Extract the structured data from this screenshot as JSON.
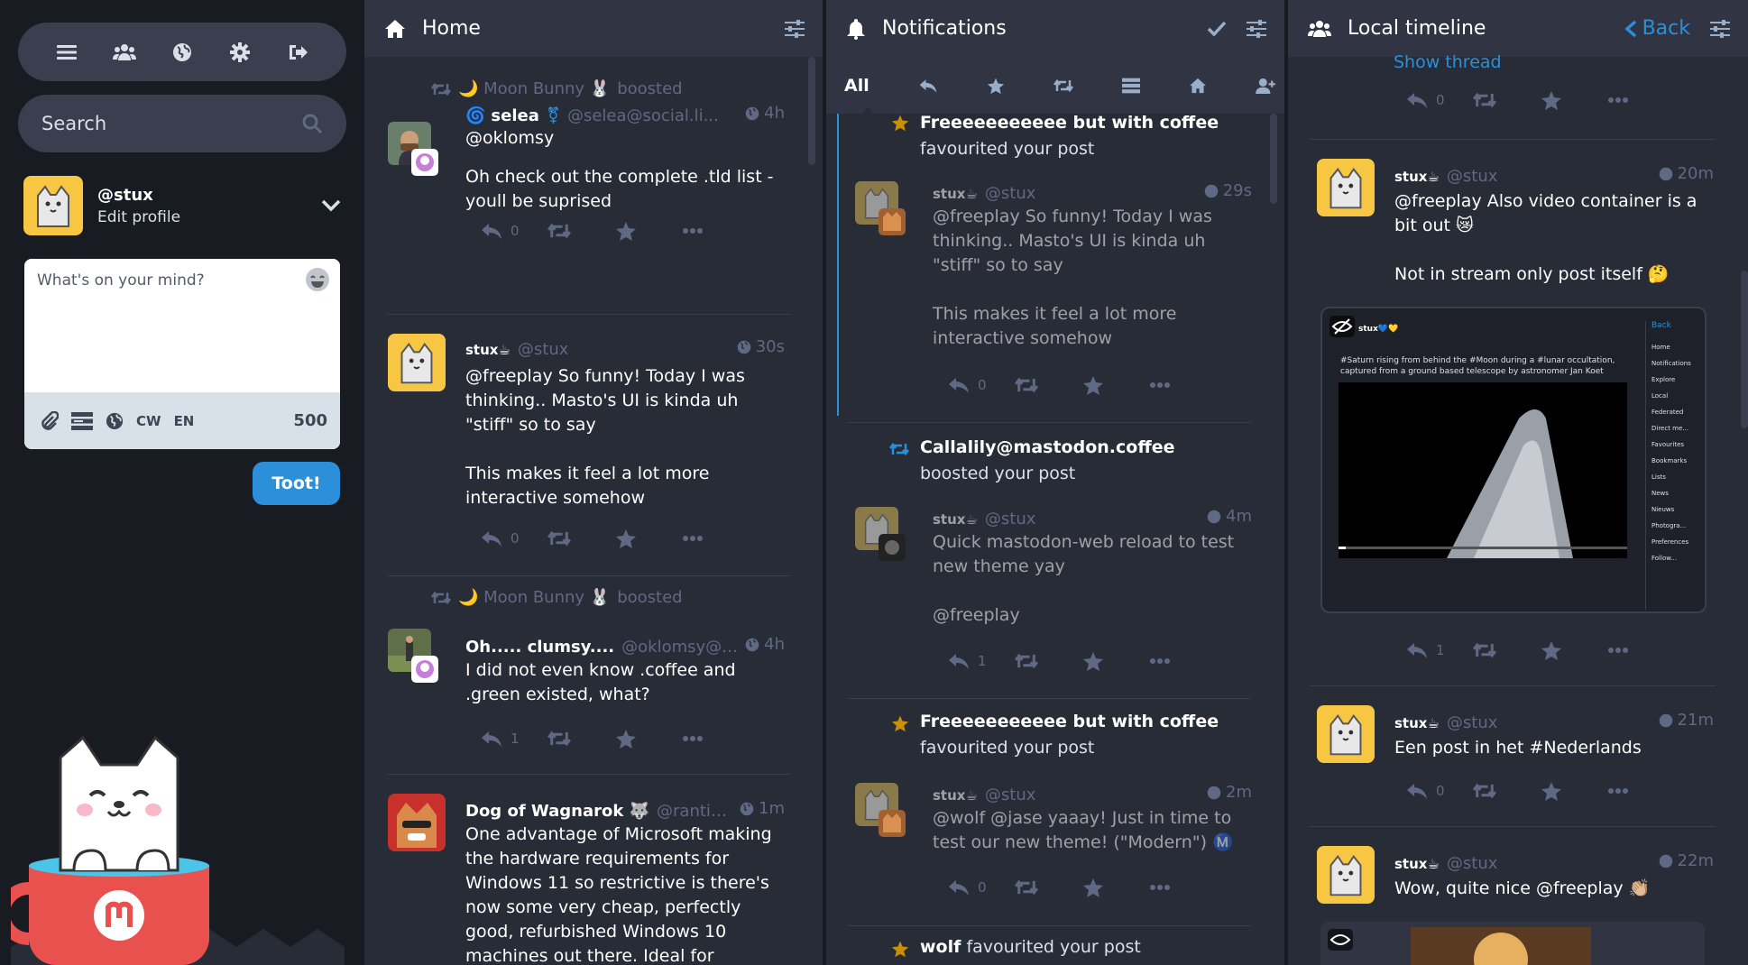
{
  "nav": {
    "items": [
      "menu",
      "people",
      "globe",
      "settings",
      "logout"
    ]
  },
  "search": {
    "placeholder": "Search"
  },
  "profile": {
    "handle": "@stux",
    "edit_label": "Edit profile"
  },
  "compose": {
    "placeholder": "What's on your mind?",
    "cw_label": "CW",
    "lang_label": "EN",
    "char_count": "500",
    "submit_label": "Toot!"
  },
  "home": {
    "title": "Home",
    "statuses": [
      {
        "boosted_by": "🌙 Moon Bunny 🐰",
        "boost_word": "boosted",
        "display_name": "selea",
        "acct": "@selea@social.li...",
        "time": "4h",
        "body1": "@oklomsy",
        "body2": "Oh check out the complete .tld list - youll be suprised",
        "replies": "0"
      },
      {
        "display_name": "stux☕",
        "acct": "@stux",
        "time": "30s",
        "body1": "@freeplay So funny! Today I was thinking.. Masto's UI is kinda uh \"stiff\" so to say",
        "body2": "This makes it feel a lot more interactive somehow",
        "replies": "0"
      },
      {
        "boosted_by": "🌙 Moon Bunny 🐰",
        "boost_word": "boosted",
        "display_name": "Oh..... clumsy....",
        "acct": "@oklomsy@s...",
        "time": "4h",
        "body1": "I did not even know .coffee and .green existed, what?",
        "replies": "1"
      },
      {
        "display_name": "Dog of Wagnarok 🐺",
        "acct": "@rantin...",
        "time": "1m",
        "body1": "One advantage of Microsoft making the hardware requirements for Windows 11 so restrictive is there's now some very cheap, perfectly good, refurbished Windows 10 machines out there. Ideal for"
      }
    ]
  },
  "notifications": {
    "title": "Notifications",
    "tabs": {
      "all": "All"
    },
    "items": [
      {
        "actor": "Freeeeeeeeeee but with coffee",
        "action": "favourited your post",
        "display_name": "stux☕",
        "acct": "@stux",
        "time": "29s",
        "body1": "@freeplay So funny! Today I was thinking.. Masto's UI is kinda uh \"stiff\" so to say",
        "body2": "This makes it feel a lot more interactive somehow",
        "replies": "0"
      },
      {
        "actor": "Callalily@mastodon.coffee",
        "action": "boosted your post",
        "display_name": "stux☕",
        "acct": "@stux",
        "time": "4m",
        "body1": "Quick mastodon-web reload to test new theme yay",
        "body2": "@freeplay",
        "replies": "1"
      },
      {
        "actor": "Freeeeeeeeeee but with coffee",
        "action": "favourited your post",
        "display_name": "stux☕",
        "acct": "@stux",
        "time": "2m",
        "body1": "@wolf @jase yaaay! Just in time to test our new theme! (\"Modern\") Ⓜ️",
        "replies": "0"
      },
      {
        "actor": "wolf",
        "action": "favourited your post"
      }
    ]
  },
  "local": {
    "title": "Local timeline",
    "back_label": "Back",
    "show_thread": "Show thread",
    "top_replies": "0",
    "statuses": [
      {
        "display_name": "stux☕",
        "acct": "@stux",
        "time": "20m",
        "body1": "@freeplay Also video container is a bit out 😿",
        "body2": "Not in stream only post itself 🤔",
        "replies": "1"
      },
      {
        "display_name": "stux☕",
        "acct": "@stux",
        "time": "21m",
        "body1": "Een post in het #Nederlands",
        "replies": "0"
      },
      {
        "display_name": "stux☕",
        "acct": "@stux",
        "time": "22m",
        "body1": "Wow, quite nice @freeplay 👏🏼"
      }
    ],
    "media_preview": {
      "user": "stux💙💛",
      "caption": "#Saturn rising from behind the #Moon during a #lunar occultation, captured from a ground based telescope by astronomer Jan Koet",
      "back": "Back",
      "menu": [
        "Home",
        "Notifications",
        "Explore",
        "Local",
        "Federated",
        "Direct me...",
        "Favourites",
        "Bookmarks",
        "Lists",
        "News",
        "Nieuws",
        "Photogra...",
        "Preferences",
        "Follow..."
      ]
    }
  },
  "colors": {
    "bg": "#191b22",
    "column": "#282c37",
    "header": "#313543",
    "accent": "#2b90d9",
    "muted": "#606984",
    "star": "#ca8f04"
  }
}
